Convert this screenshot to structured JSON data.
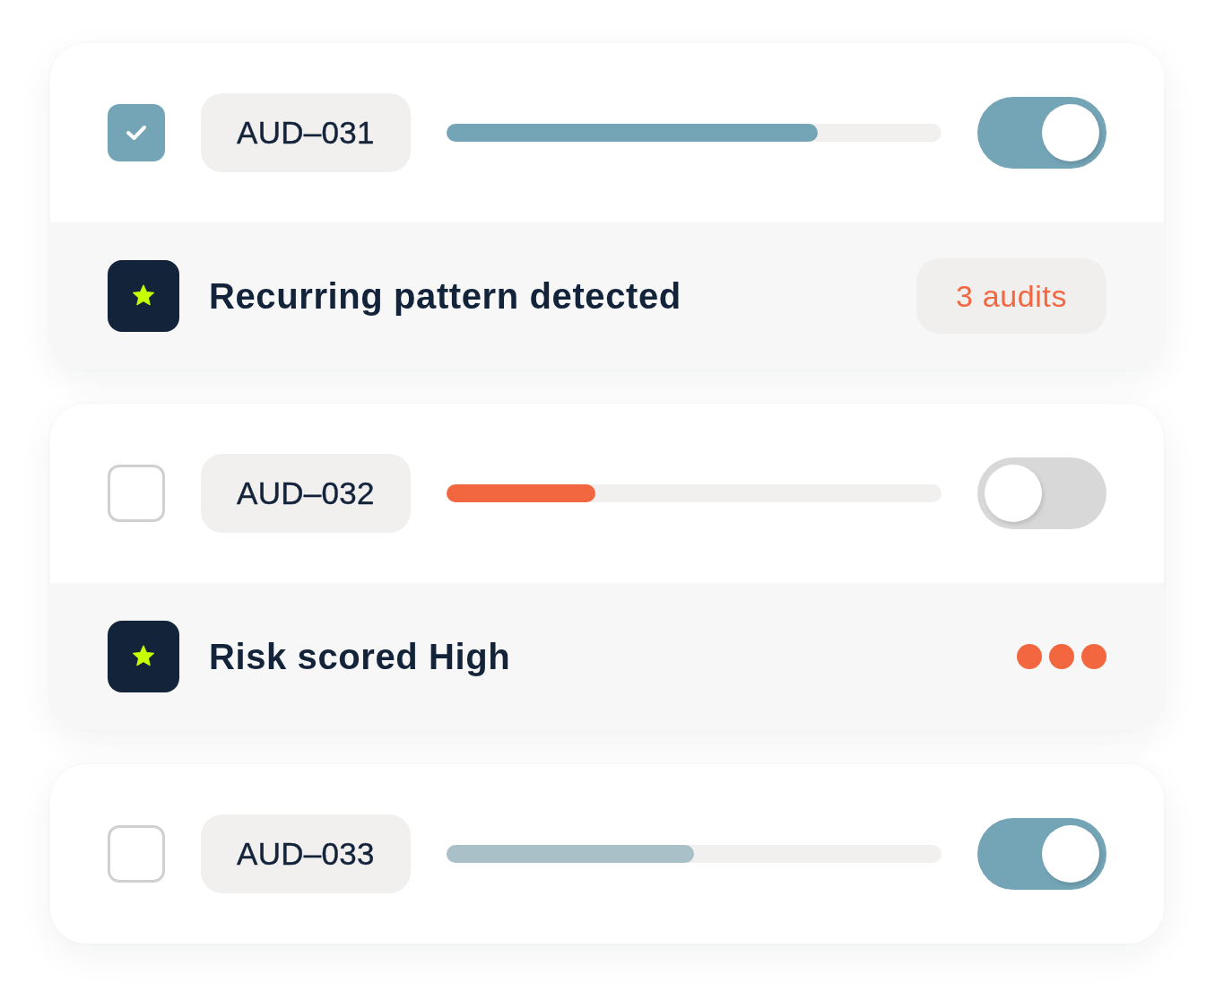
{
  "audits": [
    {
      "id": "AUD–031",
      "checked": true,
      "progress": {
        "level": 0.75,
        "color": "#74a5b6"
      },
      "on": true,
      "detail": {
        "kind": "badge",
        "title": "Recurring pattern detected",
        "badge": "3 audits"
      }
    },
    {
      "id": "AUD–032",
      "checked": false,
      "progress": {
        "level": 0.3,
        "color": "#f26640"
      },
      "on": false,
      "detail": {
        "kind": "dots",
        "title": "Risk scored High"
      }
    },
    {
      "id": "AUD–033",
      "checked": false,
      "progress": {
        "level": 0.5,
        "color": "#a9c0c8"
      },
      "on": true
    }
  ]
}
